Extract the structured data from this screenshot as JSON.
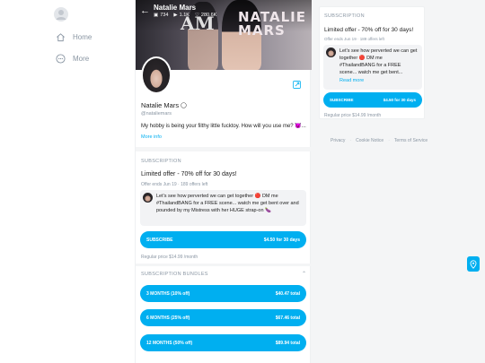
{
  "nav": {
    "items": [
      {
        "label": "Home",
        "icon": "home-icon"
      },
      {
        "label": "More",
        "icon": "more-icon"
      }
    ]
  },
  "profile": {
    "banner_name": "Natalie Mars",
    "stats": {
      "photos": "734",
      "videos": "1.1K",
      "likes": "280.6K"
    },
    "banner_brand_line1": "NATALIE",
    "banner_brand_line2": "MARS",
    "banner_mark": "AM",
    "name": "Natalie Mars",
    "handle": "@nataliemars",
    "bio": "My hobby is being your filthy little fucktoy. How will you use me? 😈...",
    "more_info": "More info"
  },
  "subscription": {
    "section_title": "SUBSCRIPTION",
    "offer_title": "Limited offer - 70% off for 30 days!",
    "offer_meta": "Offer ends Jun 19 · 189 offers left",
    "message": "Let's see how perverted we can get together 🔴 DM me #ThailandBANG for a FREE scene... watch me get bent over and pounded by my Mistress with her HUGE strap-on 🍆",
    "message_short": "Let's see how perverted we can get together 🔴 DM me #ThailandBANG for a FREE scene... watch me get bent...",
    "read_more": "Read more",
    "button_label": "SUBSCRIBE",
    "button_price": "$4.50 for 30 days",
    "regular_price": "Regular price $14.99 /month",
    "bundles_title": "SUBSCRIPTION BUNDLES",
    "bundles": [
      {
        "label": "3 MONTHS (10% off)",
        "price": "$40.47 total"
      },
      {
        "label": "6 MONTHS (25% off)",
        "price": "$67.46 total"
      },
      {
        "label": "12 MONTHS (50% off)",
        "price": "$89.94 total"
      }
    ]
  },
  "footer": {
    "links": [
      "Privacy",
      "Cookie Notice",
      "Terms of Service"
    ]
  },
  "colors": {
    "accent": "#00aff0",
    "muted": "#8a96a3",
    "background": "#f4f5f6"
  }
}
